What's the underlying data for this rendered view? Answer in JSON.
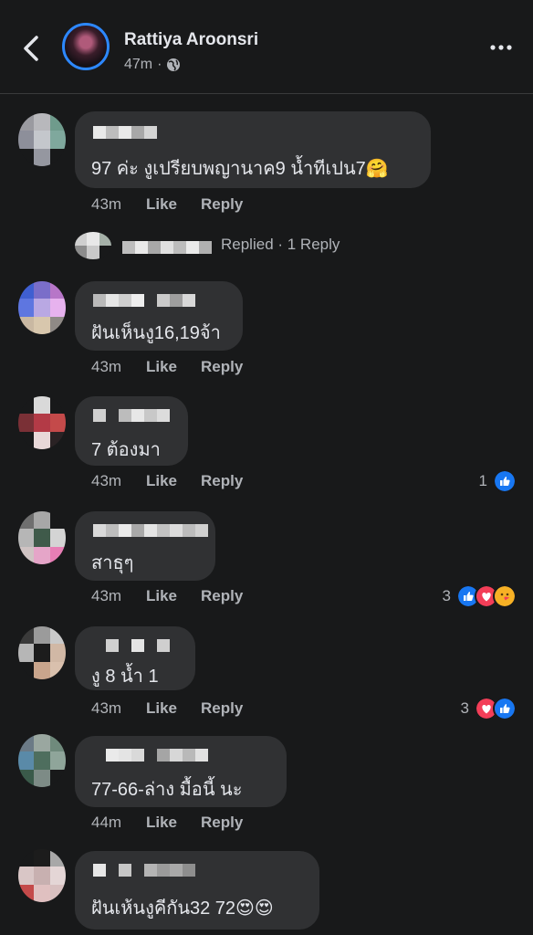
{
  "header": {
    "poster_name": "Rattiya Aroonsri",
    "time": "47m",
    "separator": "·"
  },
  "comments": [
    {
      "text": "97 ค่ะ งูเปรียบพญานาค9 น้ำทีเปน7🤗",
      "time": "43m",
      "like": "Like",
      "reply": "Reply",
      "reaction_count": ""
    },
    {
      "text": "ฝันเห็นงู16,19จ้า",
      "time": "43m",
      "like": "Like",
      "reply": "Reply",
      "reaction_count": ""
    },
    {
      "text": "7 ต้องมา",
      "time": "43m",
      "like": "Like",
      "reply": "Reply",
      "reaction_count": "1"
    },
    {
      "text": "สาธุๆ",
      "time": "43m",
      "like": "Like",
      "reply": "Reply",
      "reaction_count": "3"
    },
    {
      "text": "งู 8 น้ำ 1",
      "time": "43m",
      "like": "Like",
      "reply": "Reply",
      "reaction_count": "3"
    },
    {
      "text": "77-66-ล่าง มื้อนี้   นะ",
      "time": "44m",
      "like": "Like",
      "reply": "Reply",
      "reaction_count": ""
    },
    {
      "text": "ฝันเห้นงูคีกัน32 72😍😍",
      "time": "",
      "like": "",
      "reply": "",
      "reaction_count": ""
    }
  ],
  "replied_row": {
    "text": "Replied · 1 Reply"
  },
  "icons": {
    "back": "chevron-left-icon",
    "globe": "globe-icon",
    "more": "more-horizontal-icon",
    "like_reaction": "like-reaction-icon",
    "love_reaction": "love-reaction-icon",
    "care_reaction": "care-reaction-icon"
  },
  "colors": {
    "background": "#18191a",
    "bubble": "#303133",
    "text": "#e4e6eb",
    "secondary_text": "#b0b3b8",
    "like_blue": "#1877f2",
    "love_red": "#f33e58",
    "care_yellow": "#f7b125"
  }
}
